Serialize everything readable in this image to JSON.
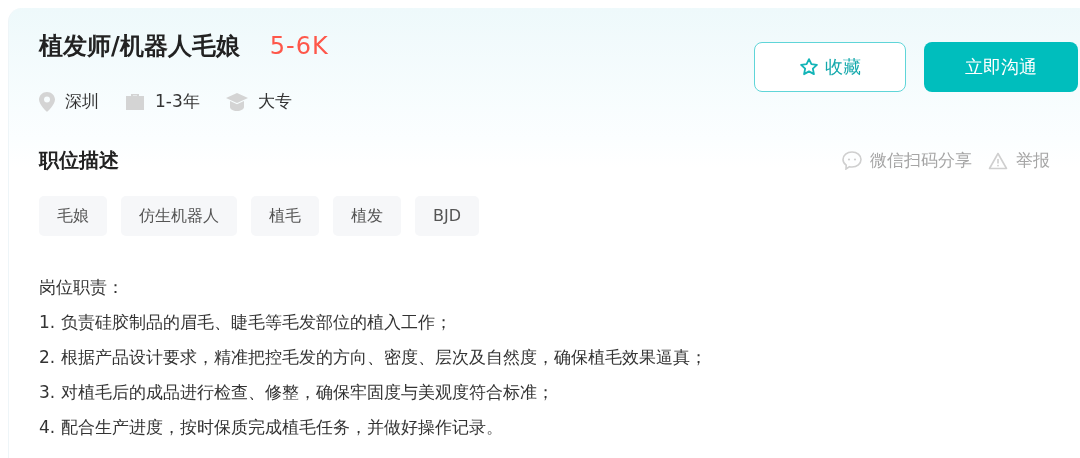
{
  "job": {
    "title": "植发师/机器人毛娘",
    "salary": "5-6K",
    "meta": [
      {
        "kind": "location",
        "text": "深圳"
      },
      {
        "kind": "experience",
        "text": "1-3年"
      },
      {
        "kind": "education",
        "text": "大专"
      }
    ]
  },
  "actions": [
    {
      "kind": "favorite",
      "label": "收藏"
    },
    {
      "kind": "chat",
      "label": "立即沟通"
    }
  ],
  "section": {
    "title": "职位描述",
    "links": [
      {
        "kind": "share",
        "label": "微信扫码分享"
      },
      {
        "kind": "report",
        "label": "举报"
      }
    ]
  },
  "tags": [
    "毛娘",
    "仿生机器人",
    "植毛",
    "植发",
    "BJD"
  ],
  "description": [
    "岗位职责：",
    "1. 负责硅胶制品的眉毛、睫毛等毛发部位的植入工作；",
    "2. 根据产品设计要求，精准把控毛发的方向、密度、层次及自然度，确保植毛效果逼真；",
    "3. 对植毛后的成品进行检查、修整，确保牢固度与美观度符合标准；",
    "4. 配合生产进度，按时保质完成植毛任务，并做好操作记录。"
  ]
}
